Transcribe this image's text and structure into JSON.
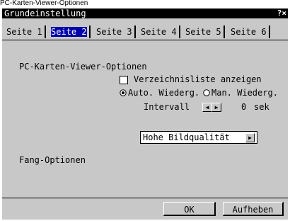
{
  "caption": "PC-Karten-Viewer-Optionen",
  "window": {
    "title": "Grundeinstellung",
    "help": "?",
    "close": "×"
  },
  "tabs": [
    {
      "label": "Seite 1",
      "active": false
    },
    {
      "label": "Seite 2",
      "active": true
    },
    {
      "label": "Seite 3",
      "active": false
    },
    {
      "label": "Seite 4",
      "active": false
    },
    {
      "label": "Seite 5",
      "active": false
    },
    {
      "label": "Seite 6",
      "active": false
    }
  ],
  "viewer": {
    "heading": "PC-Karten-Viewer-Optionen",
    "list_checkbox": {
      "label": "Verzeichnisliste anzeigen",
      "checked": false
    },
    "playback": {
      "auto_label": "Auto. Wiederg.",
      "manual_label": "Man. Wiederg.",
      "selected": "auto"
    },
    "interval": {
      "label": "Intervall",
      "value": "0",
      "unit": "sek"
    }
  },
  "capture": {
    "label": "Fang-Optionen",
    "value": "Hohe Bildqualität"
  },
  "buttons": {
    "ok": "OK",
    "cancel": "Aufheben"
  },
  "colors": {
    "face": "#c8c8c8",
    "titlebar": "#000000",
    "selection": "#0000aa"
  }
}
